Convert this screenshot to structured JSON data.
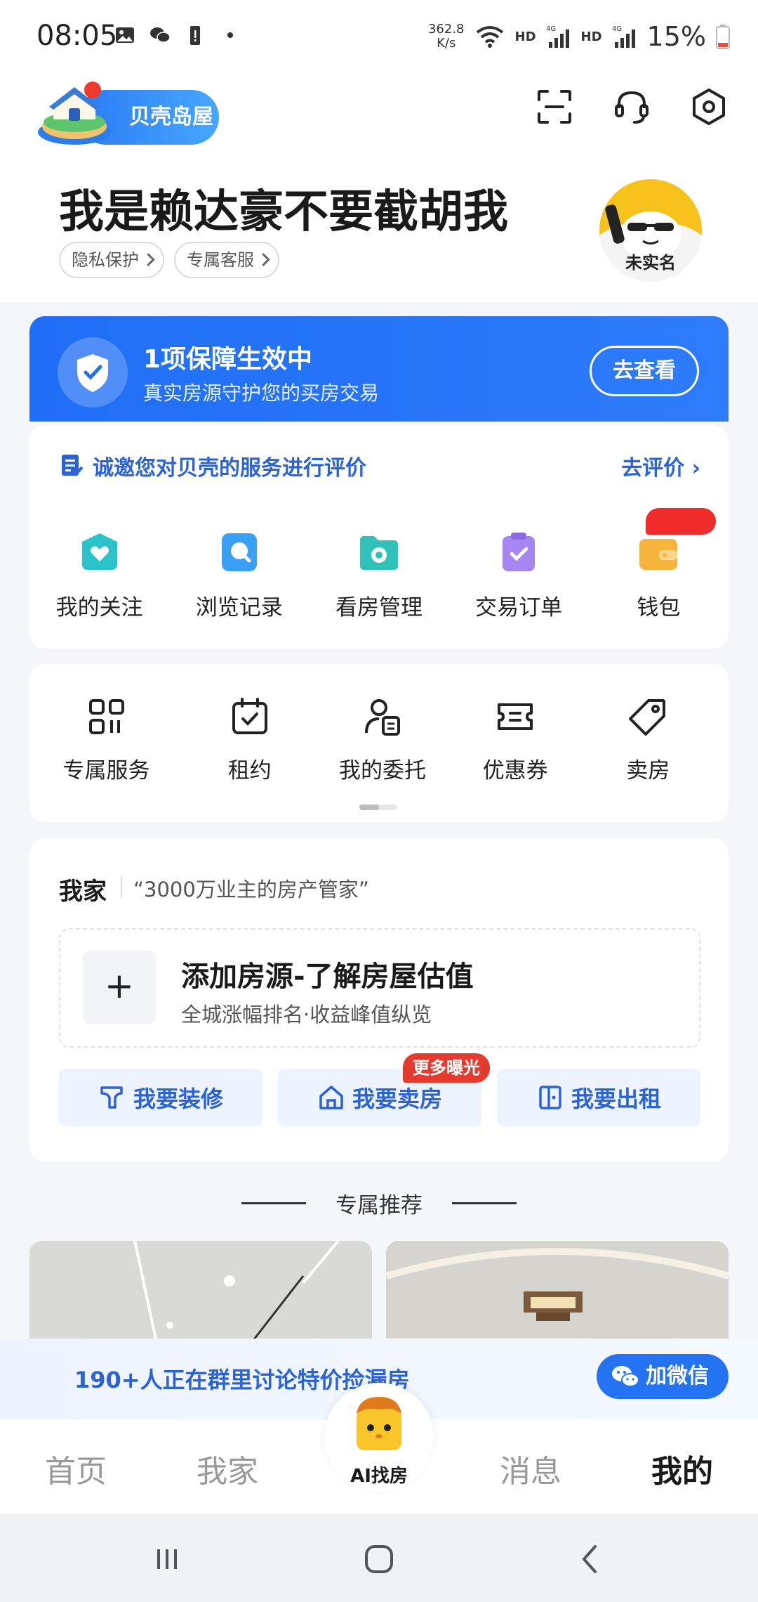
{
  "status_bar": {
    "time": "08:05",
    "net_speed_value": "362.8",
    "net_speed_unit": "K/s",
    "hd1": "HD",
    "hd2": "HD",
    "battery": "15%"
  },
  "header": {
    "brand": "贝壳岛屋",
    "username": "我是赖达豪不要截胡我",
    "tags": [
      "隐私保护",
      "专属客服"
    ],
    "avatar_label": "未实名"
  },
  "guarantee": {
    "title": "1项保障生效中",
    "subtitle": "真实房源守护您的买房交易",
    "button": "去查看"
  },
  "service": {
    "invite_text": "诚邀您对贝壳的服务进行评价",
    "invite_link": "去评价",
    "items": [
      {
        "label": "我的关注",
        "color": "#29c3c9",
        "icon": "heart-icon"
      },
      {
        "label": "浏览记录",
        "color": "#3aa0f5",
        "icon": "search-bubble-icon"
      },
      {
        "label": "看房管理",
        "color": "#2fc0b8",
        "icon": "folder-eye-icon"
      },
      {
        "label": "交易订单",
        "color": "#a585f1",
        "icon": "clipboard-check-icon"
      },
      {
        "label": "钱包",
        "color": "#f7b43c",
        "icon": "wallet-icon"
      }
    ]
  },
  "tools": {
    "items": [
      {
        "label": "专属服务",
        "icon": "grid-apps-icon"
      },
      {
        "label": "租约",
        "icon": "calendar-check-icon"
      },
      {
        "label": "我的委托",
        "icon": "user-document-icon"
      },
      {
        "label": "优惠券",
        "icon": "ticket-icon"
      },
      {
        "label": "卖房",
        "icon": "price-tag-icon"
      }
    ]
  },
  "home": {
    "title": "我家",
    "slogan": "“3000万业主的房产管家”",
    "add_plus": "+",
    "add_title": "添加房源-了解房屋估值",
    "add_subtitle": "全城涨幅排名·收益峰值纵览",
    "actions": [
      {
        "label": "我要装修",
        "icon": "paint-roller-icon"
      },
      {
        "label": "我要卖房",
        "icon": "house-icon",
        "badge": "更多曝光"
      },
      {
        "label": "我要出租",
        "icon": "door-icon"
      }
    ]
  },
  "recommend": {
    "title": "专属推荐"
  },
  "promo": {
    "text": "190+人正在群里讨论特价捡漏房",
    "button": "加微信"
  },
  "tabbar": {
    "tabs": [
      "首页",
      "我家",
      "AI找房",
      "消息",
      "我的"
    ],
    "active": "我的"
  },
  "colors": {
    "accent": "#2473f2",
    "link": "#2a62d8",
    "badge_red": "#e53b2e"
  }
}
